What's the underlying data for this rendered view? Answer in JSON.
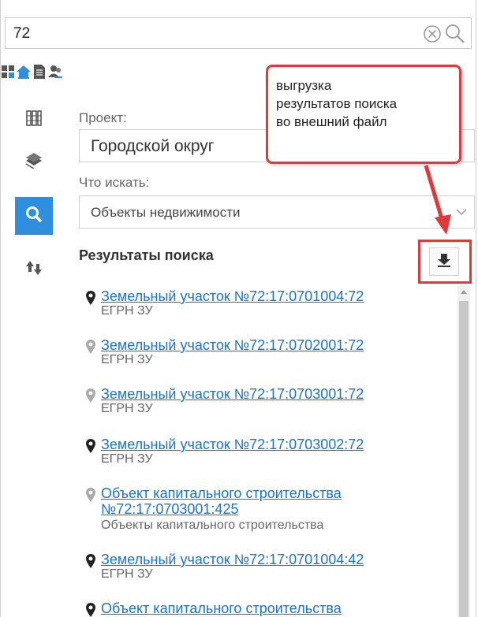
{
  "search": {
    "value": "72"
  },
  "toolbar": {
    "icons": [
      "grid-layers-icon",
      "home-icon",
      "document-icon",
      "users-icon"
    ]
  },
  "sidebar": {
    "icons": [
      "columns-icon",
      "layers-icon",
      "search-icon",
      "sort-arrows-icon"
    ],
    "active": "search-icon"
  },
  "form": {
    "project_label": "Проект:",
    "project_value": "Городской округ",
    "what_label": "Что искать:",
    "what_value": "Объекты недвижимости"
  },
  "results": {
    "title": "Результаты поиска",
    "items": [
      {
        "title": "Земельный участок №72:17:0701004:72",
        "type": "ЕГРН ЗУ",
        "pin": "dark"
      },
      {
        "title": "Земельный участок №72:17:0702001:72",
        "type": "ЕГРН ЗУ",
        "pin": "gray"
      },
      {
        "title": "Земельный участок №72:17:0703001:72",
        "type": "ЕГРН ЗУ",
        "pin": "gray"
      },
      {
        "title": "Земельный участок №72:17:0703002:72",
        "type": "ЕГРН ЗУ",
        "pin": "dark"
      },
      {
        "title_line1": "Объект капитального строительства",
        "title_line2": "№72:17:0703001:425",
        "type": "Объекты капитального строительства",
        "pin": "gray"
      },
      {
        "title": "Земельный участок №72:17:0701004:42",
        "type": "ЕГРН ЗУ",
        "pin": "dark"
      },
      {
        "title": "Объект капитального строительства",
        "pin": "dark"
      }
    ]
  },
  "callout": {
    "text_lines": [
      "выгрузка",
      "результатов поиска",
      "во внешний файл"
    ]
  },
  "colors": {
    "accent": "#2f8fdc",
    "link": "#1a73c9",
    "highlight": "#e0393c"
  }
}
